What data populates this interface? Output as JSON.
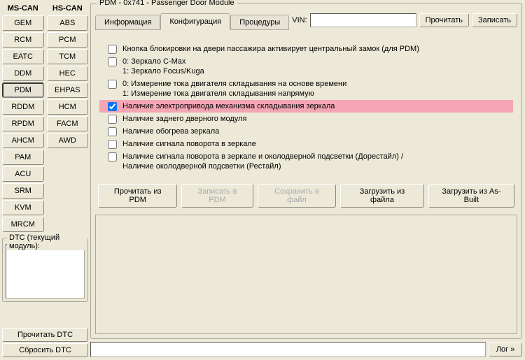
{
  "left": {
    "ms_can_label": "MS-CAN",
    "hs_can_label": "HS-CAN",
    "ms_modules": [
      "GEM",
      "RCM",
      "EATC",
      "DDM",
      "PDM",
      "RDDM",
      "RPDM",
      "AHCM",
      "PAM",
      "ACU",
      "SRM",
      "KVM",
      "MRCM"
    ],
    "ms_selected": "PDM",
    "hs_modules": [
      "ABS",
      "PCM",
      "TCM",
      "HEC",
      "EHPAS",
      "HCM",
      "FACM",
      "AWD"
    ],
    "dtc_group_label": "DTC (текущий модуль):",
    "read_dtc": "Прочитать DTC",
    "clear_dtc": "Сбросить DTC"
  },
  "main": {
    "title": "PDM - 0x741 - Passenger Door Module",
    "tabs": {
      "info": "Информация",
      "config": "Конфигурация",
      "proc": "Процедуры"
    },
    "active_tab": "config",
    "vin_label": "VIN:",
    "vin_value": "",
    "read_btn": "Прочитать",
    "write_btn": "Записать"
  },
  "config": {
    "items": [
      {
        "checked": false,
        "highlight": false,
        "text": "Кнопка блокировки на двери пассажира активирует центральный замок (для PDM)"
      },
      {
        "checked": false,
        "highlight": false,
        "text": "0: Зеркало C-Max\n1: Зеркало Focus/Kuga"
      },
      {
        "checked": false,
        "highlight": false,
        "text": "0: Измерение тока двигателя складывания на основе времени\n1: Измерение тока двигателя складывания напрямую"
      },
      {
        "checked": true,
        "highlight": true,
        "text": "Наличие электропривода механизма складывания зеркала"
      },
      {
        "checked": false,
        "highlight": false,
        "text": "Наличие заднего дверного модуля"
      },
      {
        "checked": false,
        "highlight": false,
        "text": "Наличие обогрева зеркала"
      },
      {
        "checked": false,
        "highlight": false,
        "text": "Наличие сигнала поворота в зеркале"
      },
      {
        "checked": false,
        "highlight": false,
        "text": "Наличие сигнала поворота в зеркале и околодверной подсветки (Дорестайл) /\nНаличие околодверной подсветки (Рестайл)"
      }
    ],
    "btns": {
      "read_pdm": "Прочитать из PDM",
      "write_pdm": "Записать в PDM",
      "save_file": "Сохранить в файл",
      "load_file": "Загрузить из файла",
      "load_asbuilt": "Загрузить из As-Built"
    }
  },
  "log_btn": "Лог »"
}
